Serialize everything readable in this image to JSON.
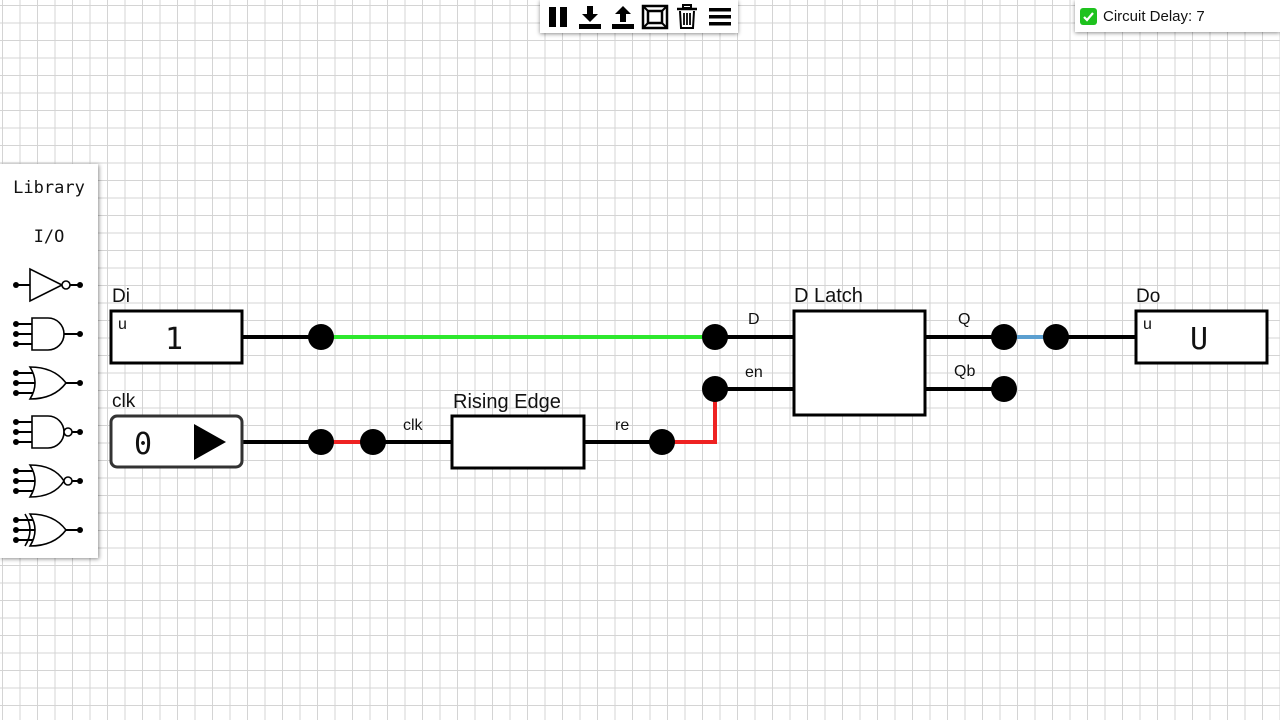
{
  "toolbar": {
    "buttons": [
      {
        "name": "pause-icon"
      },
      {
        "name": "download-icon"
      },
      {
        "name": "upload-icon"
      },
      {
        "name": "fit-screen-icon"
      },
      {
        "name": "trash-icon"
      },
      {
        "name": "menu-icon"
      }
    ]
  },
  "status": {
    "circuit_delay_label": "Circuit Delay: 7",
    "checkbox_checked": true,
    "checkbox_color": "#1ec21e"
  },
  "library": {
    "title": "Library",
    "category": "I/O",
    "gates": [
      "not-gate-icon",
      "and-gate-icon",
      "or-gate-icon",
      "nand-gate-icon",
      "nor-gate-icon",
      "xor-gate-icon"
    ]
  },
  "circuit": {
    "inputs": {
      "di": {
        "label": "Di",
        "corner": "u",
        "value": "1"
      },
      "clk": {
        "label": "clk",
        "value": "0"
      }
    },
    "rising_edge": {
      "title": "Rising Edge",
      "in_label": "clk",
      "out_label": "re"
    },
    "d_latch": {
      "title": "D Latch",
      "d_label": "D",
      "en_label": "en",
      "q_label": "Q",
      "qb_label": "Qb"
    },
    "output": {
      "label": "Do",
      "corner": "u",
      "value": "U"
    },
    "wire_colors": {
      "high": "#2ee82e",
      "low": "#ee2222",
      "unknown": "#5b9fd0",
      "neutral": "#000000"
    }
  }
}
